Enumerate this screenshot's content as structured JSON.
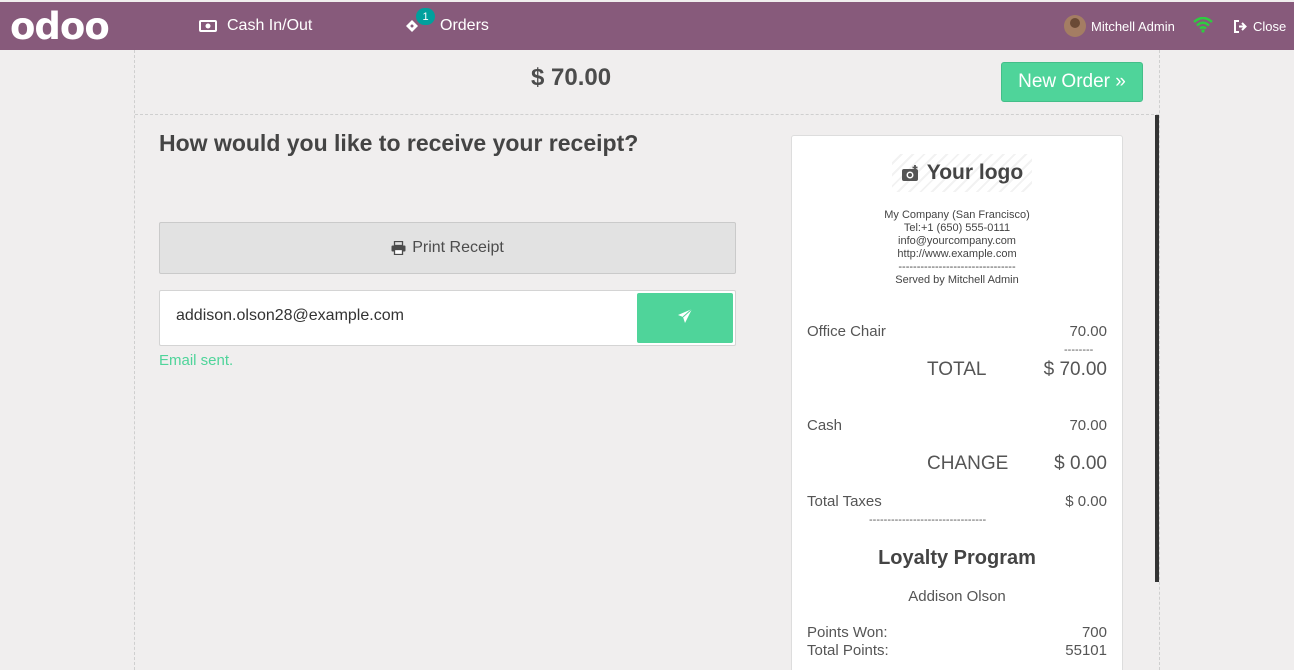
{
  "header": {
    "logo_text": "odoo",
    "cash_label": "Cash In/Out",
    "orders_label": "Orders",
    "orders_count": "1",
    "user_name": "Mitchell Admin",
    "close_label": "Close"
  },
  "order": {
    "total": "$ 70.00",
    "new_order_label": "New Order »"
  },
  "receipt_screen": {
    "question": "How would you like to receive your receipt?",
    "print_label": "Print Receipt",
    "email_value": "addison.olson28@example.com",
    "email_status": "Email sent."
  },
  "receipt": {
    "logo_text": "Your logo",
    "company_lines": [
      "My Company (San Francisco)",
      "Tel:+1 (650) 555-0111",
      "info@yourcompany.com",
      "http://www.example.com",
      "--------------------------------",
      "Served by Mitchell Admin"
    ],
    "line_item": {
      "name": "Office Chair",
      "price": "70.00"
    },
    "line_sep": "--------",
    "total_label": "TOTAL",
    "total_value": "$ 70.00",
    "payment": {
      "method": "Cash",
      "amount": "70.00"
    },
    "change_label": "CHANGE",
    "change_value": "$ 0.00",
    "taxes_label": "Total Taxes",
    "taxes_value": "$ 0.00",
    "taxes_sep": "--------------------------------",
    "loyalty_title": "Loyalty Program",
    "customer_name": "Addison Olson",
    "points_won_label": "Points Won:",
    "points_won": "700",
    "total_points_label": "Total Points:",
    "total_points": "55101"
  },
  "colors": {
    "topbar": "#875a7b",
    "accent_green": "#4fd49a",
    "badge": "#00a09d",
    "wifi": "#2ecc40"
  }
}
